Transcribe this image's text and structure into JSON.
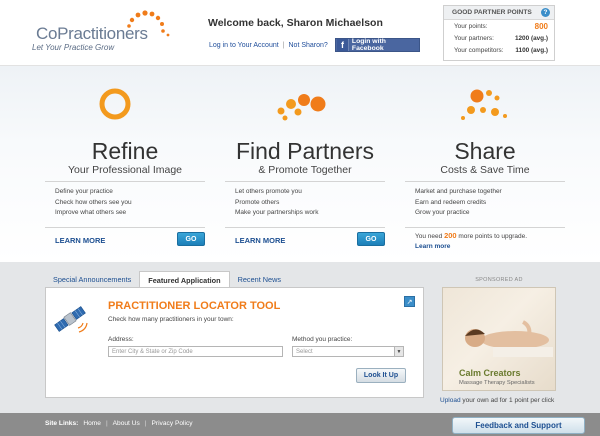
{
  "header": {
    "logo_text": "CoPractitioners",
    "logo_tagline": "Let Your Practice Grow",
    "welcome": "Welcome back, Sharon Michaelson",
    "login_link": "Log in to Your Account",
    "not_user_link": "Not Sharon?",
    "separator": "|",
    "facebook_button": "Login with Facebook"
  },
  "points": {
    "title": "GOOD PARTNER POINTS",
    "help": "?",
    "rows": [
      {
        "label": "Your points:",
        "value": "800"
      },
      {
        "label": "Your partners:",
        "value": "1200 (avg.)"
      },
      {
        "label": "Your competitors:",
        "value": "1100 (avg.)"
      }
    ]
  },
  "features": [
    {
      "title": "Refine",
      "subtitle": "Your Professional Image",
      "items": [
        "Define your practice",
        "Check how others see you",
        "Improve what others see"
      ],
      "learn_more": "LEARN MORE",
      "go": "GO"
    },
    {
      "title": "Find Partners",
      "subtitle": "& Promote Together",
      "items": [
        "Let others promote you",
        "Promote others",
        "Make your partnerships work"
      ],
      "learn_more": "LEARN MORE",
      "go": "GO"
    },
    {
      "title": "Share",
      "subtitle": "Costs & Save Time",
      "items": [
        "Market and purchase together",
        "Earn and redeem credits",
        "Grow your practice"
      ],
      "upgrade_prefix": "You need",
      "upgrade_points": "200",
      "upgrade_suffix": "more points to upgrade.",
      "learn_more": "Learn more"
    }
  ],
  "tabs": [
    "Special Announcements",
    "Featured Application",
    "Recent News"
  ],
  "tool": {
    "title": "PRACTITIONER LOCATOR TOOL",
    "subtitle": "Check how many practitioners in your town:",
    "address_label": "Address:",
    "address_placeholder": "Enter City & State or Zip Code",
    "method_label": "Method you practice:",
    "method_value": "Select",
    "submit": "Look It Up"
  },
  "ad": {
    "label": "SPONSORED AD",
    "brand": "Calm Creators",
    "tagline": "Massage Therapy Specialists",
    "upload_link": "Upload",
    "upload_text": "your own ad for 1 point per click"
  },
  "footer": {
    "label": "Site Links:",
    "links": [
      "Home",
      "About Us",
      "Privacy Policy"
    ],
    "feedback": "Feedback and Support"
  },
  "colors": {
    "accent_orange": "#f07c1a",
    "link_blue": "#1d4f91",
    "button_blue": "#1c7fb8",
    "footer_gray": "#8c8c8c"
  }
}
